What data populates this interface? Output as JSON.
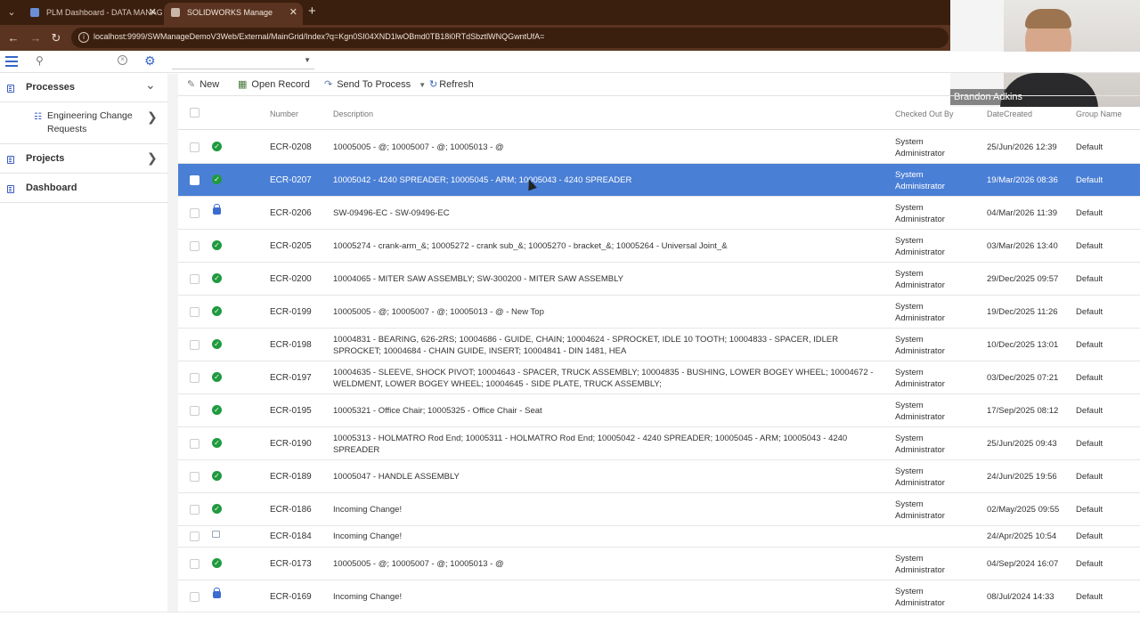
{
  "browser": {
    "tabs": [
      {
        "title": "PLM Dashboard - DATA MANAG",
        "active": false
      },
      {
        "title": "SOLIDWORKS Manage",
        "active": true
      }
    ],
    "url": "localhost:9999/SWManageDemoV3Web/External/MainGrid/Index?q=Kgn0SI04XND1lwOBmd0TB18i0RTdSbztlWNQGwntUfA="
  },
  "webcam": {
    "name": "Brandon Adkins"
  },
  "toolbar": {
    "search_placeholder": "",
    "new_label": "New",
    "open_record_label": "Open Record",
    "send_to_process_label": "Send To Process",
    "refresh_label": "Refresh"
  },
  "sidebar": {
    "processes_label": "Processes",
    "sub_item_label": "Engineering Change Requests",
    "projects_label": "Projects",
    "dashboard_label": "Dashboard"
  },
  "grid": {
    "columns": {
      "number": "Number",
      "description": "Description",
      "checked_out_by": "Checked Out By",
      "date_created": "DateCreated",
      "group_name": "Group Name"
    },
    "rows": [
      {
        "status": "check",
        "number": "ECR-0208",
        "description": "10005005 - @; 10005007 - @; 10005013 - @",
        "checked_out_by": "System Administrator",
        "date": "25/Jun/2026 12:39",
        "group": "Default",
        "h": 37
      },
      {
        "status": "check",
        "number": "ECR-0207",
        "description": "10005042 - 4240 SPREADER; 10005045 - ARM; 10005043 - 4240 SPREADER",
        "checked_out_by": "System Administrator",
        "date": "19/Mar/2026 08:36",
        "group": "Default",
        "h": 37,
        "selected": true
      },
      {
        "status": "lock",
        "number": "ECR-0206",
        "description": "SW-09496-EC - SW-09496-EC",
        "checked_out_by": "System Administrator",
        "date": "04/Mar/2026 11:39",
        "group": "Default",
        "h": 37
      },
      {
        "status": "check",
        "number": "ECR-0205",
        "description": "10005274 - crank-arm_&; 10005272 - crank sub_&; 10005270 - bracket_&; 10005264 - Universal Joint_&",
        "checked_out_by": "System Administrator",
        "date": "03/Mar/2026 13:40",
        "group": "Default",
        "h": 37
      },
      {
        "status": "check",
        "number": "ECR-0200",
        "description": "10004065 - MITER SAW ASSEMBLY; SW-300200 - MITER SAW ASSEMBLY",
        "checked_out_by": "System Administrator",
        "date": "29/Dec/2025 09:57",
        "group": "Default",
        "h": 37
      },
      {
        "status": "check",
        "number": "ECR-0199",
        "description": "10005005 - @; 10005007 - @; 10005013 - @ - New Top",
        "checked_out_by": "System Administrator",
        "date": "19/Dec/2025 11:26",
        "group": "Default",
        "h": 37
      },
      {
        "status": "check",
        "number": "ECR-0198",
        "description": "10004831 - BEARING, 626-2RS; 10004686 - GUIDE, CHAIN; 10004624 - SPROCKET, IDLE 10 TOOTH; 10004833 - SPACER, IDLER SPROCKET; 10004684 - CHAIN GUIDE, INSERT; 10004841 - DIN 1481, HEA",
        "checked_out_by": "System Administrator",
        "date": "10/Dec/2025 13:01",
        "group": "Default",
        "h": 37
      },
      {
        "status": "check",
        "number": "ECR-0197",
        "description": "10004635 - SLEEVE, SHOCK PIVOT; 10004643 - SPACER, TRUCK ASSEMBLY; 10004835 - BUSHING, LOWER BOGEY WHEEL; 10004672 - WELDMENT, LOWER BOGEY WHEEL; 10004645 - SIDE PLATE, TRUCK ASSEMBLY;",
        "checked_out_by": "System Administrator",
        "date": "03/Dec/2025 07:21",
        "group": "Default",
        "h": 37
      },
      {
        "status": "check",
        "number": "ECR-0195",
        "description": "10005321 - Office Chair; 10005325 - Office Chair - Seat",
        "checked_out_by": "System Administrator",
        "date": "17/Sep/2025 08:12",
        "group": "Default",
        "h": 37
      },
      {
        "status": "check",
        "number": "ECR-0190",
        "description": "10005313 - HOLMATRO Rod End; 10005311 - HOLMATRO Rod End; 10005042 - 4240 SPREADER; 10005045 - ARM; 10005043 - 4240 SPREADER",
        "checked_out_by": "System Administrator",
        "date": "25/Jun/2025 09:43",
        "group": "Default",
        "h": 37
      },
      {
        "status": "check",
        "number": "ECR-0189",
        "description": "10005047 - HANDLE ASSEMBLY",
        "checked_out_by": "System Administrator",
        "date": "24/Jun/2025 19:56",
        "group": "Default",
        "h": 37
      },
      {
        "status": "check",
        "number": "ECR-0186",
        "description": "Incoming Change!",
        "checked_out_by": "System Administrator",
        "date": "02/May/2025 09:55",
        "group": "Default",
        "h": 37
      },
      {
        "status": "box",
        "number": "ECR-0184",
        "description": "Incoming Change!",
        "checked_out_by": "",
        "date": "24/Apr/2025 10:54",
        "group": "Default",
        "h": 24
      },
      {
        "status": "check",
        "number": "ECR-0173",
        "description": "10005005 - @; 10005007 - @; 10005013 - @",
        "checked_out_by": "System Administrator",
        "date": "04/Sep/2024 16:07",
        "group": "Default",
        "h": 37
      },
      {
        "status": "lock",
        "number": "ECR-0169",
        "description": "Incoming Change!",
        "checked_out_by": "System Administrator",
        "date": "08/Jul/2024 14:33",
        "group": "Default",
        "h": 37
      }
    ]
  }
}
